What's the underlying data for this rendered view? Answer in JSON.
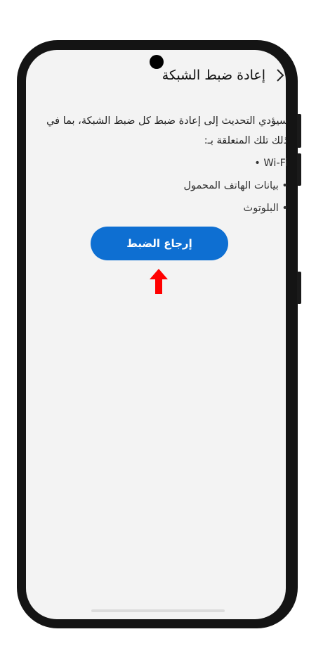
{
  "header": {
    "title": "إعادة ضبط الشبكة"
  },
  "description": "سيؤدي التحديث إلى إعادة ضبط كل ضبط الشبكة، بما في ذلك تلك المتعلقة بـ:",
  "items": [
    {
      "label": "Wi-Fi •"
    },
    {
      "label": "• بيانات الهاتف المحمول"
    },
    {
      "label": "• البلوتوث"
    }
  ],
  "button": {
    "label": "إرجاع الضبط"
  },
  "colors": {
    "accent": "#0e6fd2",
    "arrow": "#ff0000",
    "frame": "#141414",
    "screen": "#f3f3f3"
  },
  "icons": {
    "back": "chevron-right-icon",
    "indicator": "red-up-arrow-icon"
  }
}
